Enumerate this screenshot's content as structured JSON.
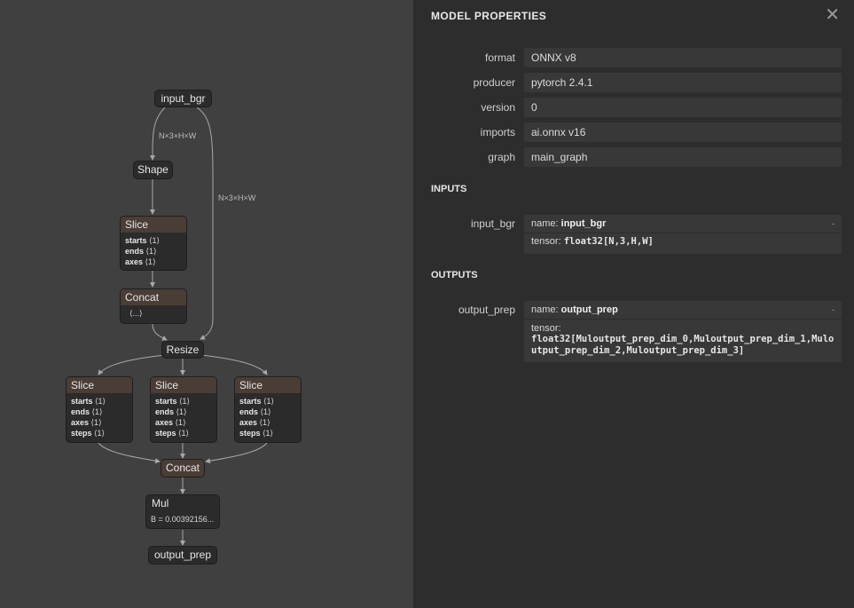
{
  "graph": {
    "nodes": {
      "input": "input_bgr",
      "shape": "Shape",
      "slice_top": {
        "title": "Slice",
        "attrs": [
          [
            "starts",
            "⟨1⟩"
          ],
          [
            "ends",
            "⟨1⟩"
          ],
          [
            "axes",
            "⟨1⟩"
          ]
        ]
      },
      "concat_top": {
        "title": "Concat",
        "body": "⟨...⟩"
      },
      "resize": "Resize",
      "slice_a": {
        "title": "Slice",
        "attrs": [
          [
            "starts",
            "⟨1⟩"
          ],
          [
            "ends",
            "⟨1⟩"
          ],
          [
            "axes",
            "⟨1⟩"
          ],
          [
            "steps",
            "⟨1⟩"
          ]
        ]
      },
      "slice_b": {
        "title": "Slice",
        "attrs": [
          [
            "starts",
            "⟨1⟩"
          ],
          [
            "ends",
            "⟨1⟩"
          ],
          [
            "axes",
            "⟨1⟩"
          ],
          [
            "steps",
            "⟨1⟩"
          ]
        ]
      },
      "slice_c": {
        "title": "Slice",
        "attrs": [
          [
            "starts",
            "⟨1⟩"
          ],
          [
            "ends",
            "⟨1⟩"
          ],
          [
            "axes",
            "⟨1⟩"
          ],
          [
            "steps",
            "⟨1⟩"
          ]
        ]
      },
      "concat_bottom": "Concat",
      "mul": {
        "title": "Mul",
        "attr": "B = 0.00392156..."
      },
      "output": "output_prep"
    },
    "edge_labels": {
      "left": "N×3×H×W",
      "right": "N×3×H×W"
    }
  },
  "panel": {
    "title": "MODEL PROPERTIES",
    "close_glyph": "✕",
    "properties": [
      {
        "label": "format",
        "value": "ONNX v8"
      },
      {
        "label": "producer",
        "value": "pytorch 2.4.1"
      },
      {
        "label": "version",
        "value": "0"
      },
      {
        "label": "imports",
        "value": "ai.onnx v16"
      },
      {
        "label": "graph",
        "value": "main_graph"
      }
    ],
    "inputs_heading": "INPUTS",
    "input": {
      "label": "input_bgr",
      "name_prefix": "name: ",
      "name": "input_bgr",
      "tensor_prefix": "tensor: ",
      "tensor": "float32[N,3,H,W]",
      "caret": "-"
    },
    "outputs_heading": "OUTPUTS",
    "output": {
      "label": "output_prep",
      "name_prefix": "name: ",
      "name": "output_prep",
      "tensor_prefix": "tensor:",
      "tensor": "float32[Muloutput_prep_dim_0,Muloutput_prep_dim_1,Muloutput_prep_dim_2,Muloutput_prep_dim_3]",
      "caret": "-"
    }
  }
}
